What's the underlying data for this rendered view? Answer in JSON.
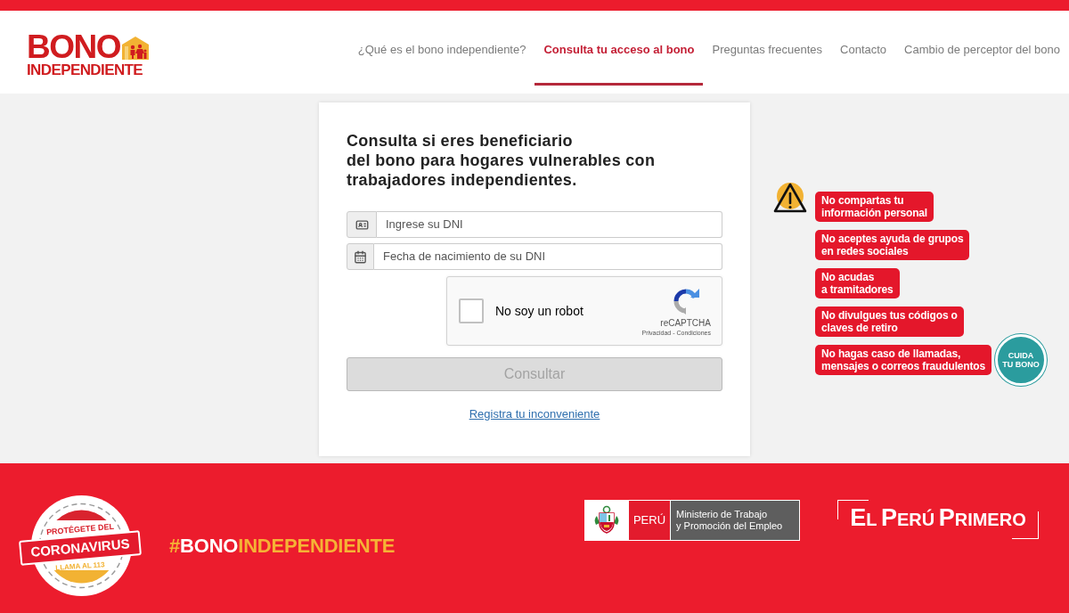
{
  "header": {
    "logo": {
      "title": "BONO",
      "subtitle": "INDEPENDIENTE"
    },
    "nav": [
      {
        "label": "¿Qué es el bono independiente?",
        "selected": false
      },
      {
        "label": "Consulta tu acceso al bono",
        "selected": true
      },
      {
        "label": "Preguntas frecuentes",
        "selected": false
      },
      {
        "label": "Contacto",
        "selected": false
      },
      {
        "label": "Cambio de perceptor del bono",
        "selected": false
      }
    ]
  },
  "form": {
    "heading_lines": [
      "Consulta si eres beneficiario",
      "del bono para hogares vulnerables con",
      "trabajadores independientes."
    ],
    "fields": [
      {
        "kind": "id",
        "placeholder": "Ingrese su DNI"
      },
      {
        "kind": "date",
        "placeholder": "Fecha de nacimiento de su DNI"
      }
    ],
    "captcha": {
      "label": "No soy un robot",
      "checked": false,
      "brand": "reCAPTCHA",
      "links": "Privacidad - Condiciones"
    },
    "submit": {
      "label": "Consultar",
      "disabled": true
    },
    "link": "Registra tu inconveniente"
  },
  "warnings": {
    "items": [
      {
        "lines": [
          "No compartas tu",
          "información personal"
        ]
      },
      {
        "lines": [
          "No aceptes ayuda de grupos",
          "en redes sociales"
        ]
      },
      {
        "lines": [
          "No acudas",
          "a tramitadores"
        ]
      },
      {
        "lines": [
          "No divulgues tus códigos o",
          "claves de retiro"
        ]
      },
      {
        "lines": [
          "No hagas caso de llamadas,",
          "mensajes o correos fraudulentos"
        ]
      }
    ],
    "sticker_lines": [
      "CUIDA",
      "TU BONO"
    ]
  },
  "footer": {
    "seal": {
      "top": "PROTÉGETE DEL",
      "banner": "CORONAVIRUS",
      "bottom": "LLAMA AL 113"
    },
    "hashtag": [
      {
        "text": "#",
        "kind": "accent"
      },
      {
        "text": "BONO",
        "kind": "light"
      },
      {
        "text": "INDEPENDIENTE",
        "kind": "accent"
      }
    ],
    "ministry": {
      "country": "PERÚ",
      "name_lines": [
        "Ministerio de Trabajo",
        "y Promoción del Empleo"
      ]
    },
    "slogan": "EL PERÚ PRIMERO"
  }
}
